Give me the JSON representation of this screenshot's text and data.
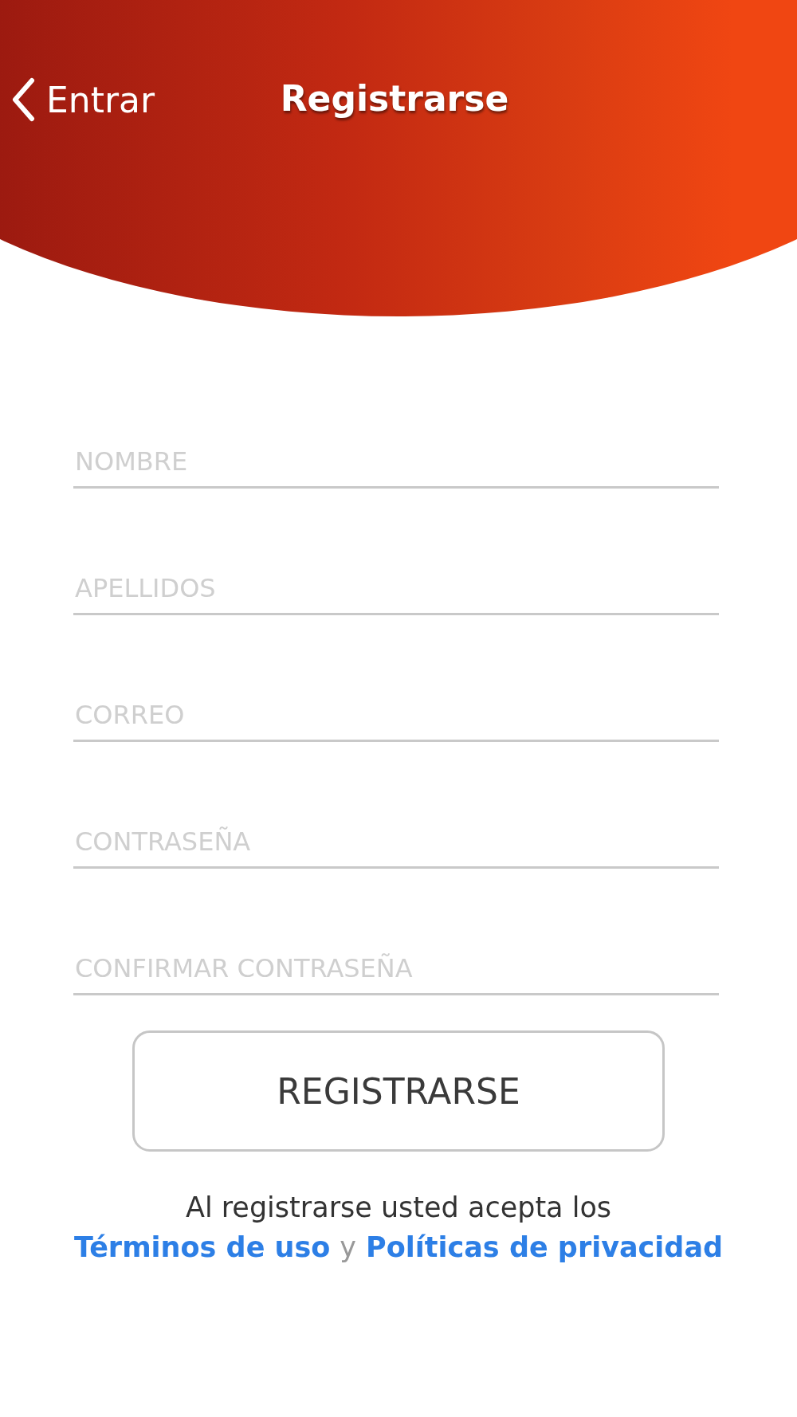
{
  "header": {
    "back_label": "Entrar",
    "title": "Registrarse"
  },
  "fields": [
    {
      "placeholder": "NOMBRE"
    },
    {
      "placeholder": "APELLIDOS"
    },
    {
      "placeholder": "CORREO"
    },
    {
      "placeholder": "CONTRASEÑA"
    },
    {
      "placeholder": "CONFIRMAR CONTRASEÑA"
    }
  ],
  "submit_button": "REGISTRARSE",
  "terms": {
    "text": "Al registrarse usted acepta los",
    "first_link": "Términos de uso",
    "conjunction": "y",
    "second_link": "Políticas de privacidad"
  }
}
